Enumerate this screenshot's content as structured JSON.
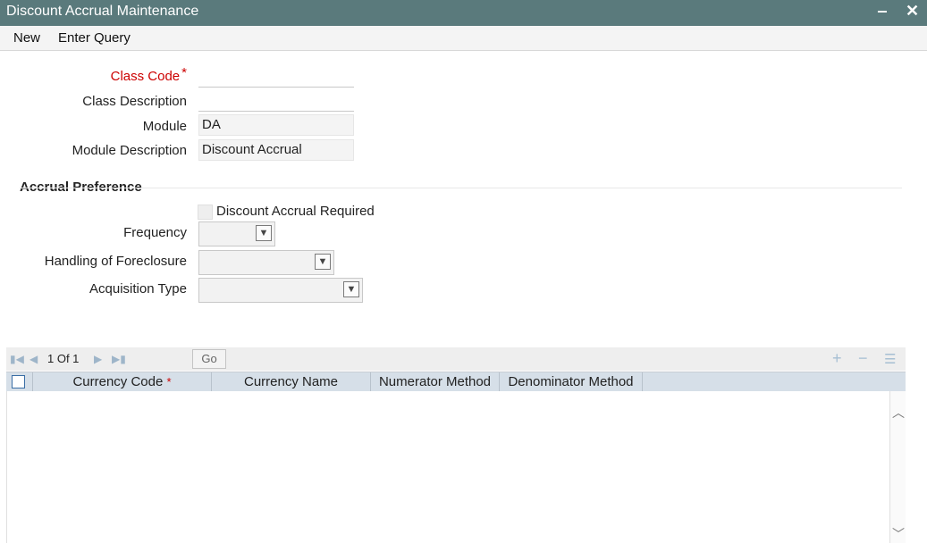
{
  "window": {
    "title": "Discount Accrual Maintenance",
    "minimize": "‒",
    "close": "✕"
  },
  "menu": {
    "new": "New",
    "enter_query": "Enter Query"
  },
  "form": {
    "class_code_label": "Class Code",
    "required_mark": "*",
    "class_code_value": "",
    "class_description_label": "Class Description",
    "class_description_value": "",
    "module_label": "Module",
    "module_value": "DA",
    "module_description_label": "Module Description",
    "module_description_value": "Discount Accrual"
  },
  "accrual_preference": {
    "section_title": "Accrual Preference",
    "discount_accrual_required_label": "Discount Accrual Required",
    "discount_accrual_required_checked": false,
    "frequency_label": "Frequency",
    "frequency_value": "",
    "handling_of_foreclosure_label": "Handling of Foreclosure",
    "handling_of_foreclosure_value": "",
    "acquisition_type_label": "Acquisition Type",
    "acquisition_type_value": ""
  },
  "grid": {
    "pagination": "1 Of 1",
    "go_label": "Go",
    "columns": [
      {
        "label": "Currency Code",
        "required": true
      },
      {
        "label": "Currency Name",
        "required": false
      },
      {
        "label": "Numerator Method",
        "required": false
      },
      {
        "label": "Denominator Method",
        "required": false
      }
    ],
    "rows": []
  },
  "colors": {
    "titlebar": "#5a7a7c",
    "required": "#cc0000",
    "grid_header": "#d6dfe8"
  },
  "icons": {
    "first_page": "first-page-icon",
    "prev_page": "prev-page-icon",
    "next_page": "next-page-icon",
    "last_page": "last-page-icon",
    "add_row": "plus-icon",
    "delete_row": "minus-icon",
    "single_view": "list-icon",
    "scroll_up": "chevron-up-icon",
    "scroll_down": "chevron-down-icon"
  }
}
